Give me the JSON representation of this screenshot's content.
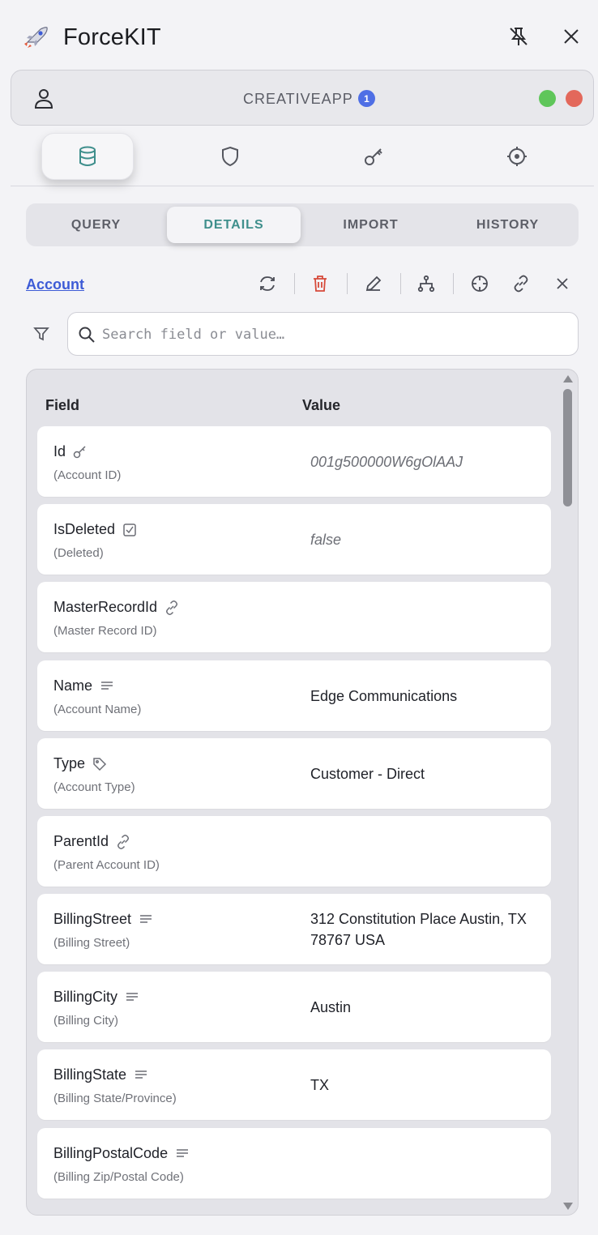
{
  "app": {
    "title": "ForceKIT"
  },
  "org": {
    "name": "CREATIVEAPP",
    "badge": "1"
  },
  "sub_tabs": [
    "QUERY",
    "DETAILS",
    "IMPORT",
    "HISTORY"
  ],
  "object": {
    "name": "Account"
  },
  "search": {
    "placeholder": "Search field or value…"
  },
  "columns": {
    "field": "Field",
    "value": "Value"
  },
  "rows": [
    {
      "api": "Id",
      "label": "(Account ID)",
      "value": "001g500000W6gOlAAJ",
      "italic": true,
      "icon": "key-icon"
    },
    {
      "api": "IsDeleted",
      "label": "(Deleted)",
      "value": "false",
      "italic": true,
      "icon": "checkbox-icon"
    },
    {
      "api": "MasterRecordId",
      "label": "(Master Record ID)",
      "value": "",
      "italic": false,
      "icon": "link-icon"
    },
    {
      "api": "Name",
      "label": "(Account Name)",
      "value": "Edge Communications",
      "italic": false,
      "icon": "text-icon"
    },
    {
      "api": "Type",
      "label": "(Account Type)",
      "value": "Customer - Direct",
      "italic": false,
      "icon": "tag-icon"
    },
    {
      "api": "ParentId",
      "label": "(Parent Account ID)",
      "value": "",
      "italic": false,
      "icon": "link-icon"
    },
    {
      "api": "BillingStreet",
      "label": "(Billing Street)",
      "value": "312 Constitution Place Austin, TX 78767 USA",
      "italic": false,
      "icon": "text-icon"
    },
    {
      "api": "BillingCity",
      "label": "(Billing City)",
      "value": "Austin",
      "italic": false,
      "icon": "text-icon"
    },
    {
      "api": "BillingState",
      "label": "(Billing State/Province)",
      "value": "TX",
      "italic": false,
      "icon": "text-icon"
    },
    {
      "api": "BillingPostalCode",
      "label": "(Billing Zip/Postal Code)",
      "value": "",
      "italic": false,
      "icon": "text-icon"
    }
  ],
  "colors": {
    "accent": "#3f8f8c",
    "link": "#3d5bd6",
    "danger": "#d64a3a",
    "status_green": "#5fc65a",
    "status_red": "#e3685b",
    "badge": "#4f6fe5"
  }
}
